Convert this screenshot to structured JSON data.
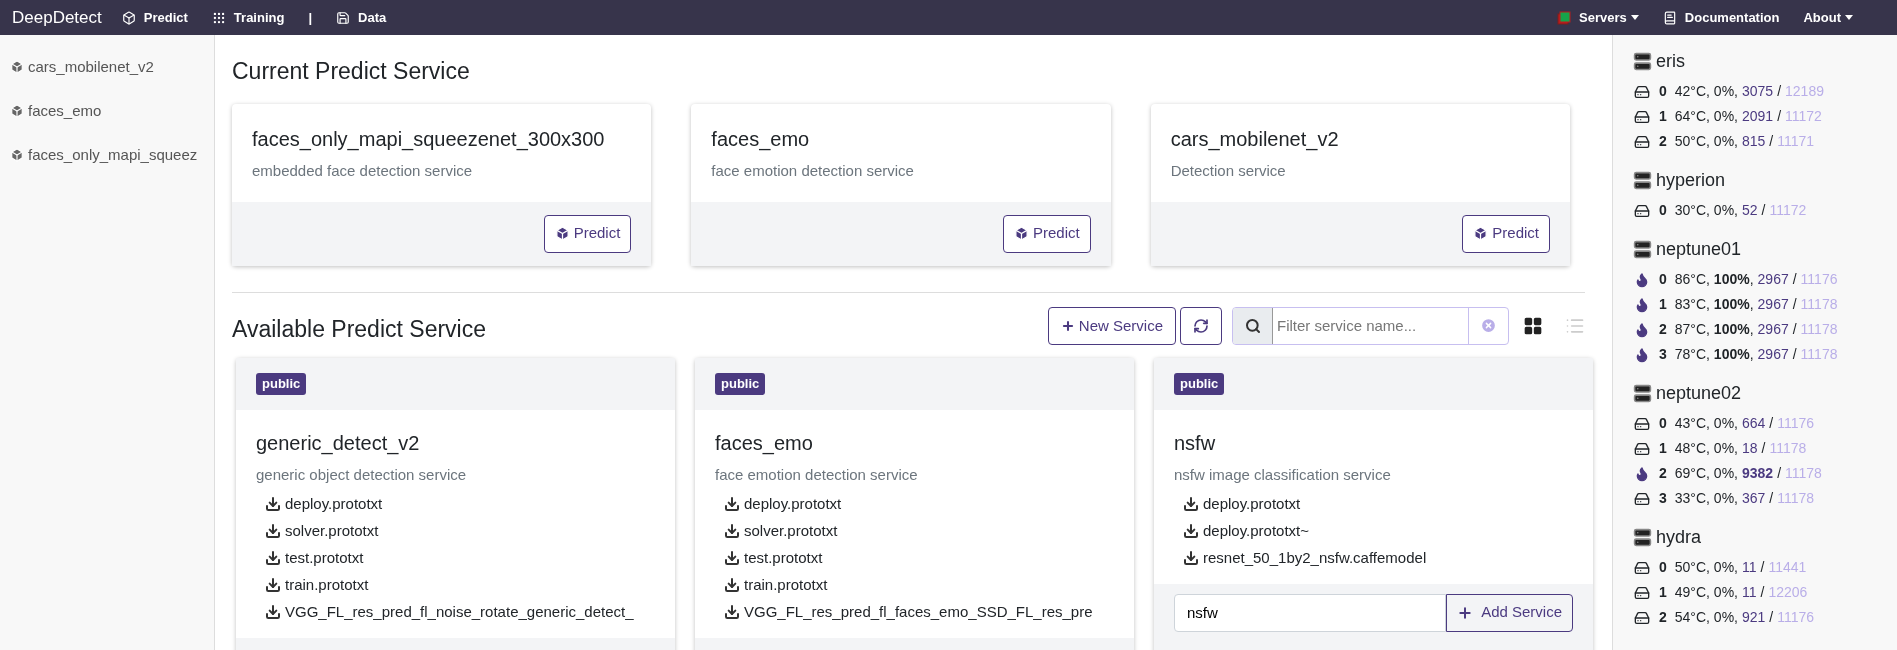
{
  "navbar": {
    "brand": "DeepDetect",
    "links": [
      {
        "kind": "predict",
        "label": "Predict"
      },
      {
        "kind": "training",
        "label": "Training"
      },
      {
        "kind": "separator",
        "label": "|"
      },
      {
        "kind": "data",
        "label": "Data"
      }
    ],
    "right_links": [
      {
        "kind": "servers",
        "label": "Servers",
        "dropdown": true
      },
      {
        "kind": "docs",
        "label": "Documentation",
        "dropdown": false
      },
      {
        "kind": "about",
        "label": "About",
        "dropdown": true
      }
    ]
  },
  "sidebar": {
    "items": [
      "cars_mobilenet_v2",
      "faces_emo",
      "faces_only_mapi_squeez"
    ]
  },
  "current": {
    "title": "Current Predict Service",
    "services": [
      {
        "name": "faces_only_mapi_squeezenet_300x300",
        "description": "embedded face detection service",
        "button": "Predict"
      },
      {
        "name": "faces_emo",
        "description": "face emotion detection service",
        "button": "Predict"
      },
      {
        "name": "cars_mobilenet_v2",
        "description": "Detection service",
        "button": "Predict"
      }
    ]
  },
  "available": {
    "title": "Available Predict Service",
    "new_button": "New Service",
    "filter": {
      "placeholder": "Filter service name..."
    },
    "view_modes": [
      {
        "kind": "grid",
        "selected": true
      },
      {
        "kind": "list",
        "selected": false
      }
    ],
    "services": [
      {
        "badge": "public",
        "name": "generic_detect_v2",
        "description": "generic object detection service",
        "files": [
          "deploy.prototxt",
          "solver.prototxt",
          "test.prototxt",
          "train.prototxt",
          "VGG_FL_res_pred_fl_noise_rotate_generic_detect_"
        ]
      },
      {
        "badge": "public",
        "name": "faces_emo",
        "description": "face emotion detection service",
        "files": [
          "deploy.prototxt",
          "solver.prototxt",
          "test.prototxt",
          "train.prototxt",
          "VGG_FL_res_pred_fl_faces_emo_SSD_FL_res_pre"
        ]
      },
      {
        "badge": "public",
        "name": "nsfw",
        "description": "nsfw image classification service",
        "files": [
          "deploy.prototxt",
          "deploy.prototxt~",
          "resnet_50_1by2_nsfw.caffemodel"
        ],
        "add": {
          "value": "nsfw",
          "button": "Add Service"
        }
      }
    ]
  },
  "servers": {
    "separator": "/",
    "list": [
      {
        "name": "eris",
        "gpus": [
          {
            "kind": "idle",
            "index": "0",
            "stats": "42°C, 0%,",
            "mem_used": "3075",
            "mem_high": false,
            "mem_total": "12189"
          },
          {
            "kind": "idle",
            "index": "1",
            "stats": "64°C, 0%,",
            "mem_used": "2091",
            "mem_high": false,
            "mem_total": "11172"
          },
          {
            "kind": "idle",
            "index": "2",
            "stats": "50°C, 0%,",
            "mem_used": "815",
            "mem_high": false,
            "mem_total": "11171"
          }
        ]
      },
      {
        "name": "hyperion",
        "gpus": [
          {
            "kind": "idle",
            "index": "0",
            "stats": "30°C, 0%,",
            "mem_used": "52",
            "mem_high": false,
            "mem_total": "11172"
          }
        ]
      },
      {
        "name": "neptune01",
        "gpus": [
          {
            "kind": "busy",
            "index": "0",
            "stats": "86°C, **100%**,",
            "mem_used": "2967",
            "mem_high": false,
            "mem_total": "11176"
          },
          {
            "kind": "busy",
            "index": "1",
            "stats": "83°C, **100%**,",
            "mem_used": "2967",
            "mem_high": false,
            "mem_total": "11178"
          },
          {
            "kind": "busy",
            "index": "2",
            "stats": "87°C, **100%**,",
            "mem_used": "2967",
            "mem_high": false,
            "mem_total": "11178"
          },
          {
            "kind": "busy",
            "index": "3",
            "stats": "78°C, **100%**,",
            "mem_used": "2967",
            "mem_high": false,
            "mem_total": "11178"
          }
        ]
      },
      {
        "name": "neptune02",
        "gpus": [
          {
            "kind": "idle",
            "index": "0",
            "stats": "43°C, 0%,",
            "mem_used": "664",
            "mem_high": false,
            "mem_total": "11176"
          },
          {
            "kind": "idle",
            "index": "1",
            "stats": "48°C, 0%,",
            "mem_used": "18",
            "mem_high": false,
            "mem_total": "11178"
          },
          {
            "kind": "busy",
            "index": "2",
            "stats": "69°C, 0%,",
            "mem_used": "9382",
            "mem_high": true,
            "mem_total": "11178"
          },
          {
            "kind": "idle",
            "index": "3",
            "stats": "33°C, 0%,",
            "mem_used": "367",
            "mem_high": false,
            "mem_total": "11178"
          }
        ]
      },
      {
        "name": "hydra",
        "gpus": [
          {
            "kind": "idle",
            "index": "0",
            "stats": "50°C, 0%,",
            "mem_used": "11",
            "mem_high": false,
            "mem_total": "11441"
          },
          {
            "kind": "idle",
            "index": "1",
            "stats": "49°C, 0%,",
            "mem_used": "11",
            "mem_high": false,
            "mem_total": "12206"
          },
          {
            "kind": "idle",
            "index": "2",
            "stats": "54°C, 0%,",
            "mem_used": "921",
            "mem_high": false,
            "mem_total": "11176"
          }
        ]
      }
    ]
  }
}
